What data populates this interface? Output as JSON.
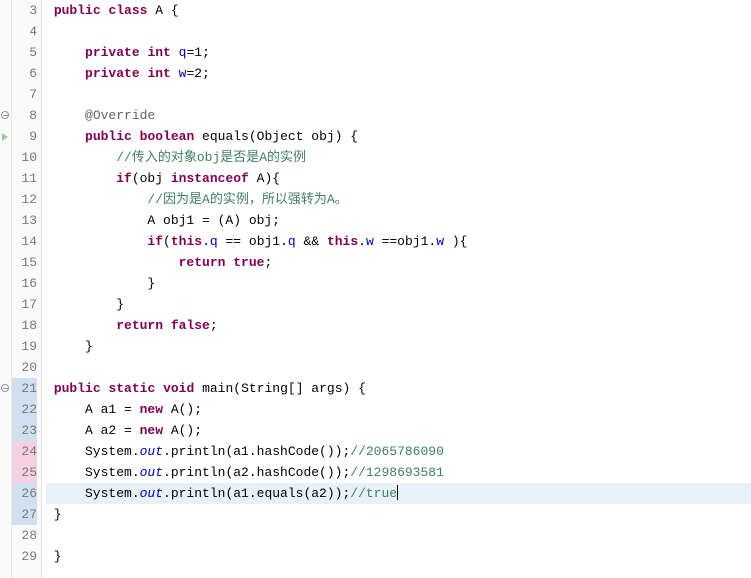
{
  "lines": [
    {
      "num": "3",
      "marker": "",
      "cls": "",
      "segs": [
        {
          "t": " "
        },
        {
          "t": "public",
          "c": "kw"
        },
        {
          "t": " "
        },
        {
          "t": "class",
          "c": "kw"
        },
        {
          "t": " A {"
        }
      ]
    },
    {
      "num": "4",
      "marker": "",
      "cls": "",
      "segs": []
    },
    {
      "num": "5",
      "marker": "",
      "cls": "",
      "segs": [
        {
          "t": "     "
        },
        {
          "t": "private",
          "c": "kw"
        },
        {
          "t": " "
        },
        {
          "t": "int",
          "c": "kw"
        },
        {
          "t": " "
        },
        {
          "t": "q",
          "c": "field-ref"
        },
        {
          "t": "=1;"
        }
      ]
    },
    {
      "num": "6",
      "marker": "",
      "cls": "",
      "segs": [
        {
          "t": "     "
        },
        {
          "t": "private",
          "c": "kw"
        },
        {
          "t": " "
        },
        {
          "t": "int",
          "c": "kw"
        },
        {
          "t": " "
        },
        {
          "t": "w",
          "c": "field-ref"
        },
        {
          "t": "=2;"
        }
      ]
    },
    {
      "num": "7",
      "marker": "",
      "cls": "",
      "segs": []
    },
    {
      "num": "8",
      "marker": "circle",
      "cls": "",
      "segs": [
        {
          "t": "     "
        },
        {
          "t": "@Override",
          "c": "ann"
        }
      ]
    },
    {
      "num": "9",
      "marker": "triangle",
      "cls": "",
      "segs": [
        {
          "t": "     "
        },
        {
          "t": "public",
          "c": "kw"
        },
        {
          "t": " "
        },
        {
          "t": "boolean",
          "c": "kw"
        },
        {
          "t": " equals(Object obj) {"
        }
      ]
    },
    {
      "num": "10",
      "marker": "",
      "cls": "",
      "segs": [
        {
          "t": "         "
        },
        {
          "t": "//传入的对象obj是否是A的实例",
          "c": "comment"
        }
      ]
    },
    {
      "num": "11",
      "marker": "",
      "cls": "",
      "segs": [
        {
          "t": "         "
        },
        {
          "t": "if",
          "c": "kw"
        },
        {
          "t": "(obj "
        },
        {
          "t": "instanceof",
          "c": "kw"
        },
        {
          "t": " A){"
        }
      ]
    },
    {
      "num": "12",
      "marker": "",
      "cls": "",
      "segs": [
        {
          "t": "             "
        },
        {
          "t": "//因为是A的实例，所以强转为A。",
          "c": "comment"
        }
      ]
    },
    {
      "num": "13",
      "marker": "",
      "cls": "",
      "segs": [
        {
          "t": "             A obj1 = (A) obj;"
        }
      ]
    },
    {
      "num": "14",
      "marker": "",
      "cls": "",
      "segs": [
        {
          "t": "             "
        },
        {
          "t": "if",
          "c": "kw"
        },
        {
          "t": "("
        },
        {
          "t": "this",
          "c": "kw"
        },
        {
          "t": "."
        },
        {
          "t": "q",
          "c": "field-ref"
        },
        {
          "t": " == obj1."
        },
        {
          "t": "q",
          "c": "field-ref"
        },
        {
          "t": " && "
        },
        {
          "t": "this",
          "c": "kw"
        },
        {
          "t": "."
        },
        {
          "t": "w",
          "c": "field-ref"
        },
        {
          "t": " ==obj1."
        },
        {
          "t": "w",
          "c": "field-ref"
        },
        {
          "t": " ){"
        }
      ]
    },
    {
      "num": "15",
      "marker": "",
      "cls": "",
      "segs": [
        {
          "t": "                 "
        },
        {
          "t": "return",
          "c": "kw"
        },
        {
          "t": " "
        },
        {
          "t": "true",
          "c": "kw"
        },
        {
          "t": ";"
        }
      ]
    },
    {
      "num": "16",
      "marker": "",
      "cls": "",
      "segs": [
        {
          "t": "             }"
        }
      ]
    },
    {
      "num": "17",
      "marker": "",
      "cls": "",
      "segs": [
        {
          "t": "         }"
        }
      ]
    },
    {
      "num": "18",
      "marker": "",
      "cls": "",
      "segs": [
        {
          "t": "         "
        },
        {
          "t": "return",
          "c": "kw"
        },
        {
          "t": " "
        },
        {
          "t": "false",
          "c": "kw"
        },
        {
          "t": ";"
        }
      ]
    },
    {
      "num": "19",
      "marker": "",
      "cls": "",
      "segs": [
        {
          "t": "     }"
        }
      ]
    },
    {
      "num": "20",
      "marker": "",
      "cls": "",
      "segs": []
    },
    {
      "num": "21",
      "marker": "circle",
      "cls": "hl-blue",
      "segs": [
        {
          "t": " "
        },
        {
          "t": "public",
          "c": "kw"
        },
        {
          "t": " "
        },
        {
          "t": "static",
          "c": "kw"
        },
        {
          "t": " "
        },
        {
          "t": "void",
          "c": "kw"
        },
        {
          "t": " main(String[] args) {"
        }
      ]
    },
    {
      "num": "22",
      "marker": "",
      "cls": "hl-blue",
      "segs": [
        {
          "t": "     A a1 = "
        },
        {
          "t": "new",
          "c": "kw"
        },
        {
          "t": " A();"
        }
      ]
    },
    {
      "num": "23",
      "marker": "",
      "cls": "hl-blue",
      "segs": [
        {
          "t": "     A a2 = "
        },
        {
          "t": "new",
          "c": "kw"
        },
        {
          "t": " A();"
        }
      ]
    },
    {
      "num": "24",
      "marker": "",
      "cls": "hl-pink",
      "segs": [
        {
          "t": "     System."
        },
        {
          "t": "out",
          "c": "static-ref"
        },
        {
          "t": ".println(a1.hashCode());"
        },
        {
          "t": "//2065786090",
          "c": "comment-num"
        }
      ]
    },
    {
      "num": "25",
      "marker": "",
      "cls": "hl-pink",
      "segs": [
        {
          "t": "     System."
        },
        {
          "t": "out",
          "c": "static-ref"
        },
        {
          "t": ".println(a2.hashCode());"
        },
        {
          "t": "//1298693581",
          "c": "comment-num"
        }
      ]
    },
    {
      "num": "26",
      "marker": "",
      "cls": "hl-current",
      "segs": [
        {
          "t": "     System."
        },
        {
          "t": "out",
          "c": "static-ref"
        },
        {
          "t": ".println(a1.equals(a2));"
        },
        {
          "t": "//true",
          "c": "comment-num"
        }
      ],
      "cursor": true
    },
    {
      "num": "27",
      "marker": "",
      "cls": "hl-blue",
      "segs": [
        {
          "t": " }"
        }
      ]
    },
    {
      "num": "28",
      "marker": "",
      "cls": "",
      "segs": []
    },
    {
      "num": "29",
      "marker": "",
      "cls": "",
      "segs": [
        {
          "t": " }"
        }
      ]
    }
  ]
}
